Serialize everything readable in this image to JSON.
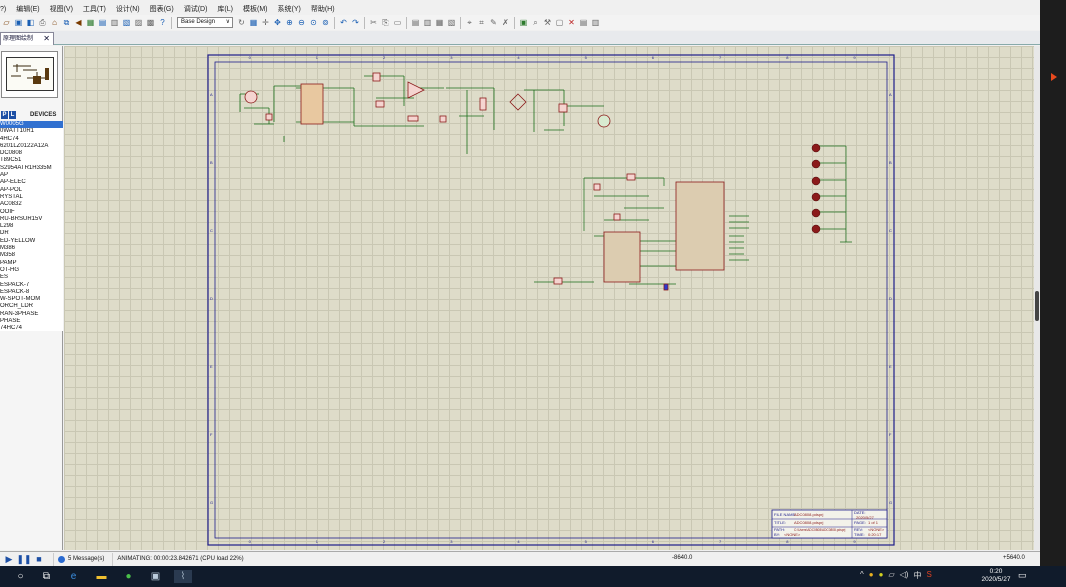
{
  "menu": [
    "?)",
    "编辑(E)",
    "视图(V)",
    "工具(T)",
    "设计(N)",
    "图表(G)",
    "调试(D)",
    "库(L)",
    "模板(M)",
    "系统(Y)",
    "帮助(H)"
  ],
  "toolbar": {
    "layer": "Base Design"
  },
  "tab": {
    "label": "原理图绘制",
    "close": "✕"
  },
  "panel": {
    "p_btn": "P",
    "l_btn": "L",
    "devices_label": "DEVICES"
  },
  "devices": [
    "W0005G",
    "0WATT10R1",
    "4HC74",
    "6201LZ0122A12A",
    "DC0808",
    "T89C51",
    "S2954ATR1H335M",
    "AP",
    "AP-ELEC",
    "AP-POL",
    "RYSTAL",
    "AC0832",
    "OOIF",
    "RU-BRSUR15V",
    "L298",
    "DR",
    "ED-YELLOW",
    "M386",
    "M358",
    "PAMP",
    "OT-HG",
    "ES",
    "ESPACK-7",
    "ESPACK-8",
    "W-SPOT-MOM",
    "ORCH_LDR",
    "RAN-3PHASE",
    "PHASE",
    "74HC74"
  ],
  "status": {
    "messages": "5 Message(s)",
    "animating": "ANIMATING: 00:00:23.842671 (CPU load 22%)",
    "coord_x": "-8640.0",
    "coord_y": "+5640.0"
  },
  "titleblock": {
    "file_name_label": "FILE NAME:",
    "file_name": "ADC0808.pdsprj",
    "date_label": "DATE:",
    "date": "2020/5/27",
    "title_label": "TITLE:",
    "title": "ADC0808.pdsprj",
    "page_label": "PAGE:",
    "page": "1 of 1",
    "path_label": "PATH:",
    "path": "C:\\Users\\ADC0808\\ADC0808.pdsprj",
    "rev": "REV:",
    "time": "TIME:",
    "by_label": "BY:",
    "by": "<NONE>",
    "rev_val": "<NONE>",
    "time_val": "0:20:17"
  },
  "clock": {
    "time": "0:20",
    "date": "2020/5/27"
  },
  "colors": {
    "canvas": "#dedcc9",
    "wire": "#1a6e1a",
    "component": "#8b1a1a",
    "taskbar": "#101b2b",
    "accent": "#e8491d"
  },
  "icons": [
    "new-icon",
    "open-icon",
    "save-icon",
    "print-icon",
    "zoom-in-icon",
    "zoom-out-icon",
    "undo-icon",
    "redo-icon",
    "cut-icon",
    "copy-icon",
    "paste-icon",
    "play-icon",
    "pause-icon",
    "stop-icon"
  ]
}
